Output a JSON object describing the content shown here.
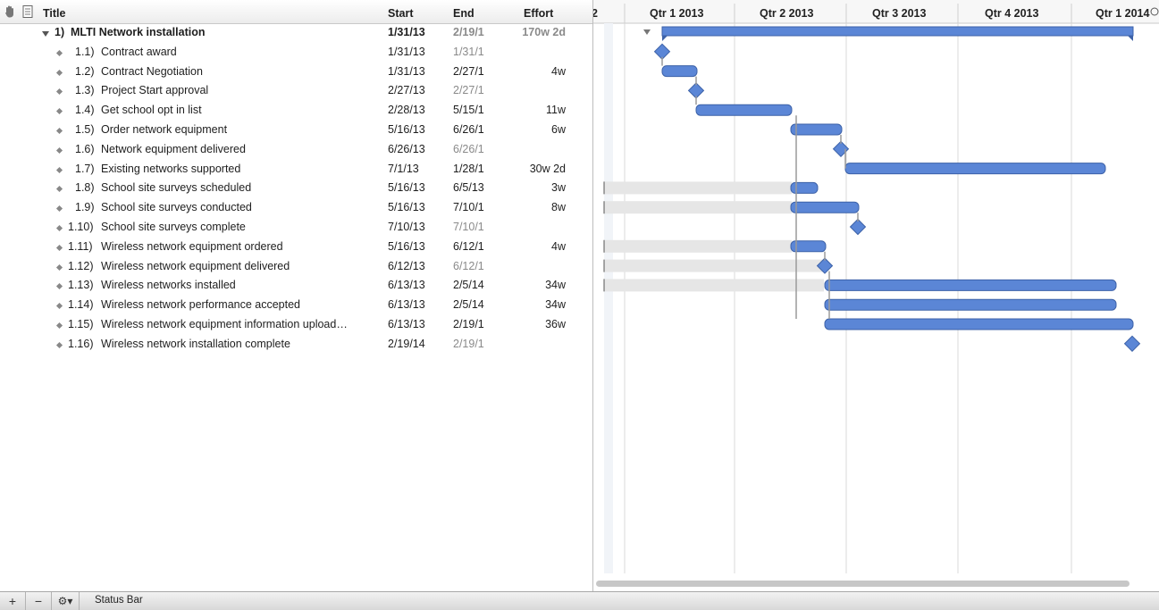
{
  "outline": {
    "columns": {
      "title": "Title",
      "start": "Start",
      "end": "End",
      "effort": "Effort"
    },
    "rows": [
      {
        "num": "1)",
        "title": "MLTI Network installation",
        "start": "1/31/13",
        "end": "2/19/1",
        "effort": "170w 2d",
        "kind": "group"
      },
      {
        "num": "1.1)",
        "title": "Contract award",
        "start": "1/31/13",
        "end": "1/31/1",
        "effort": "",
        "kind": "milestone"
      },
      {
        "num": "1.2)",
        "title": "Contract Negotiation",
        "start": "1/31/13",
        "end": "2/27/1",
        "effort": "4w",
        "kind": "task"
      },
      {
        "num": "1.3)",
        "title": "Project Start approval",
        "start": "2/27/13",
        "end": "2/27/1",
        "effort": "",
        "kind": "milestone"
      },
      {
        "num": "1.4)",
        "title": "Get school opt in list",
        "start": "2/28/13",
        "end": "5/15/1",
        "effort": "11w",
        "kind": "task"
      },
      {
        "num": "1.5)",
        "title": "Order network equipment",
        "start": "5/16/13",
        "end": "6/26/1",
        "effort": "6w",
        "kind": "task"
      },
      {
        "num": "1.6)",
        "title": "Network equipment delivered",
        "start": "6/26/13",
        "end": "6/26/1",
        "effort": "",
        "kind": "milestone"
      },
      {
        "num": "1.7)",
        "title": "Existing networks supported",
        "start": "7/1/13",
        "end": "1/28/1",
        "effort": "30w 2d",
        "kind": "task"
      },
      {
        "num": "1.8)",
        "title": "School site surveys scheduled",
        "start": "5/16/13",
        "end": "6/5/13",
        "effort": "3w",
        "kind": "task"
      },
      {
        "num": "1.9)",
        "title": "School site surveys conducted",
        "start": "5/16/13",
        "end": "7/10/1",
        "effort": "8w",
        "kind": "task"
      },
      {
        "num": "1.10)",
        "title": "School site surveys complete",
        "start": "7/10/13",
        "end": "7/10/1",
        "effort": "",
        "kind": "milestone"
      },
      {
        "num": "1.11)",
        "title": "Wireless network equipment ordered",
        "start": "5/16/13",
        "end": "6/12/1",
        "effort": "4w",
        "kind": "task"
      },
      {
        "num": "1.12)",
        "title": "Wireless network equipment delivered",
        "start": "6/12/13",
        "end": "6/12/1",
        "effort": "",
        "kind": "milestone"
      },
      {
        "num": "1.13)",
        "title": "Wireless networks installed",
        "start": "6/13/13",
        "end": "2/5/14",
        "effort": "34w",
        "kind": "task"
      },
      {
        "num": "1.14)",
        "title": "Wireless network performance accepted",
        "start": "6/13/13",
        "end": "2/5/14",
        "effort": "34w",
        "kind": "task"
      },
      {
        "num": "1.15)",
        "title": "Wireless network equipment information upload…",
        "start": "6/13/13",
        "end": "2/19/1",
        "effort": "36w",
        "kind": "task"
      },
      {
        "num": "1.16)",
        "title": "Wireless network installation complete",
        "start": "2/19/14",
        "end": "2/19/1",
        "effort": "",
        "kind": "milestone"
      }
    ]
  },
  "gantt": {
    "timeline_labels": [
      "2",
      "Qtr 1 2013",
      "Qtr 2 2013",
      "Qtr 3 2013",
      "Qtr 4 2013",
      "Qtr 1 2014"
    ],
    "bar_color": "#5b86d6",
    "milestone_color": "#5b86d6",
    "slack_color": "#e6e6e6"
  },
  "statusbar": {
    "add_label": "+",
    "remove_label": "−",
    "action_label": "⚙▾",
    "status_text": "Status Bar"
  }
}
